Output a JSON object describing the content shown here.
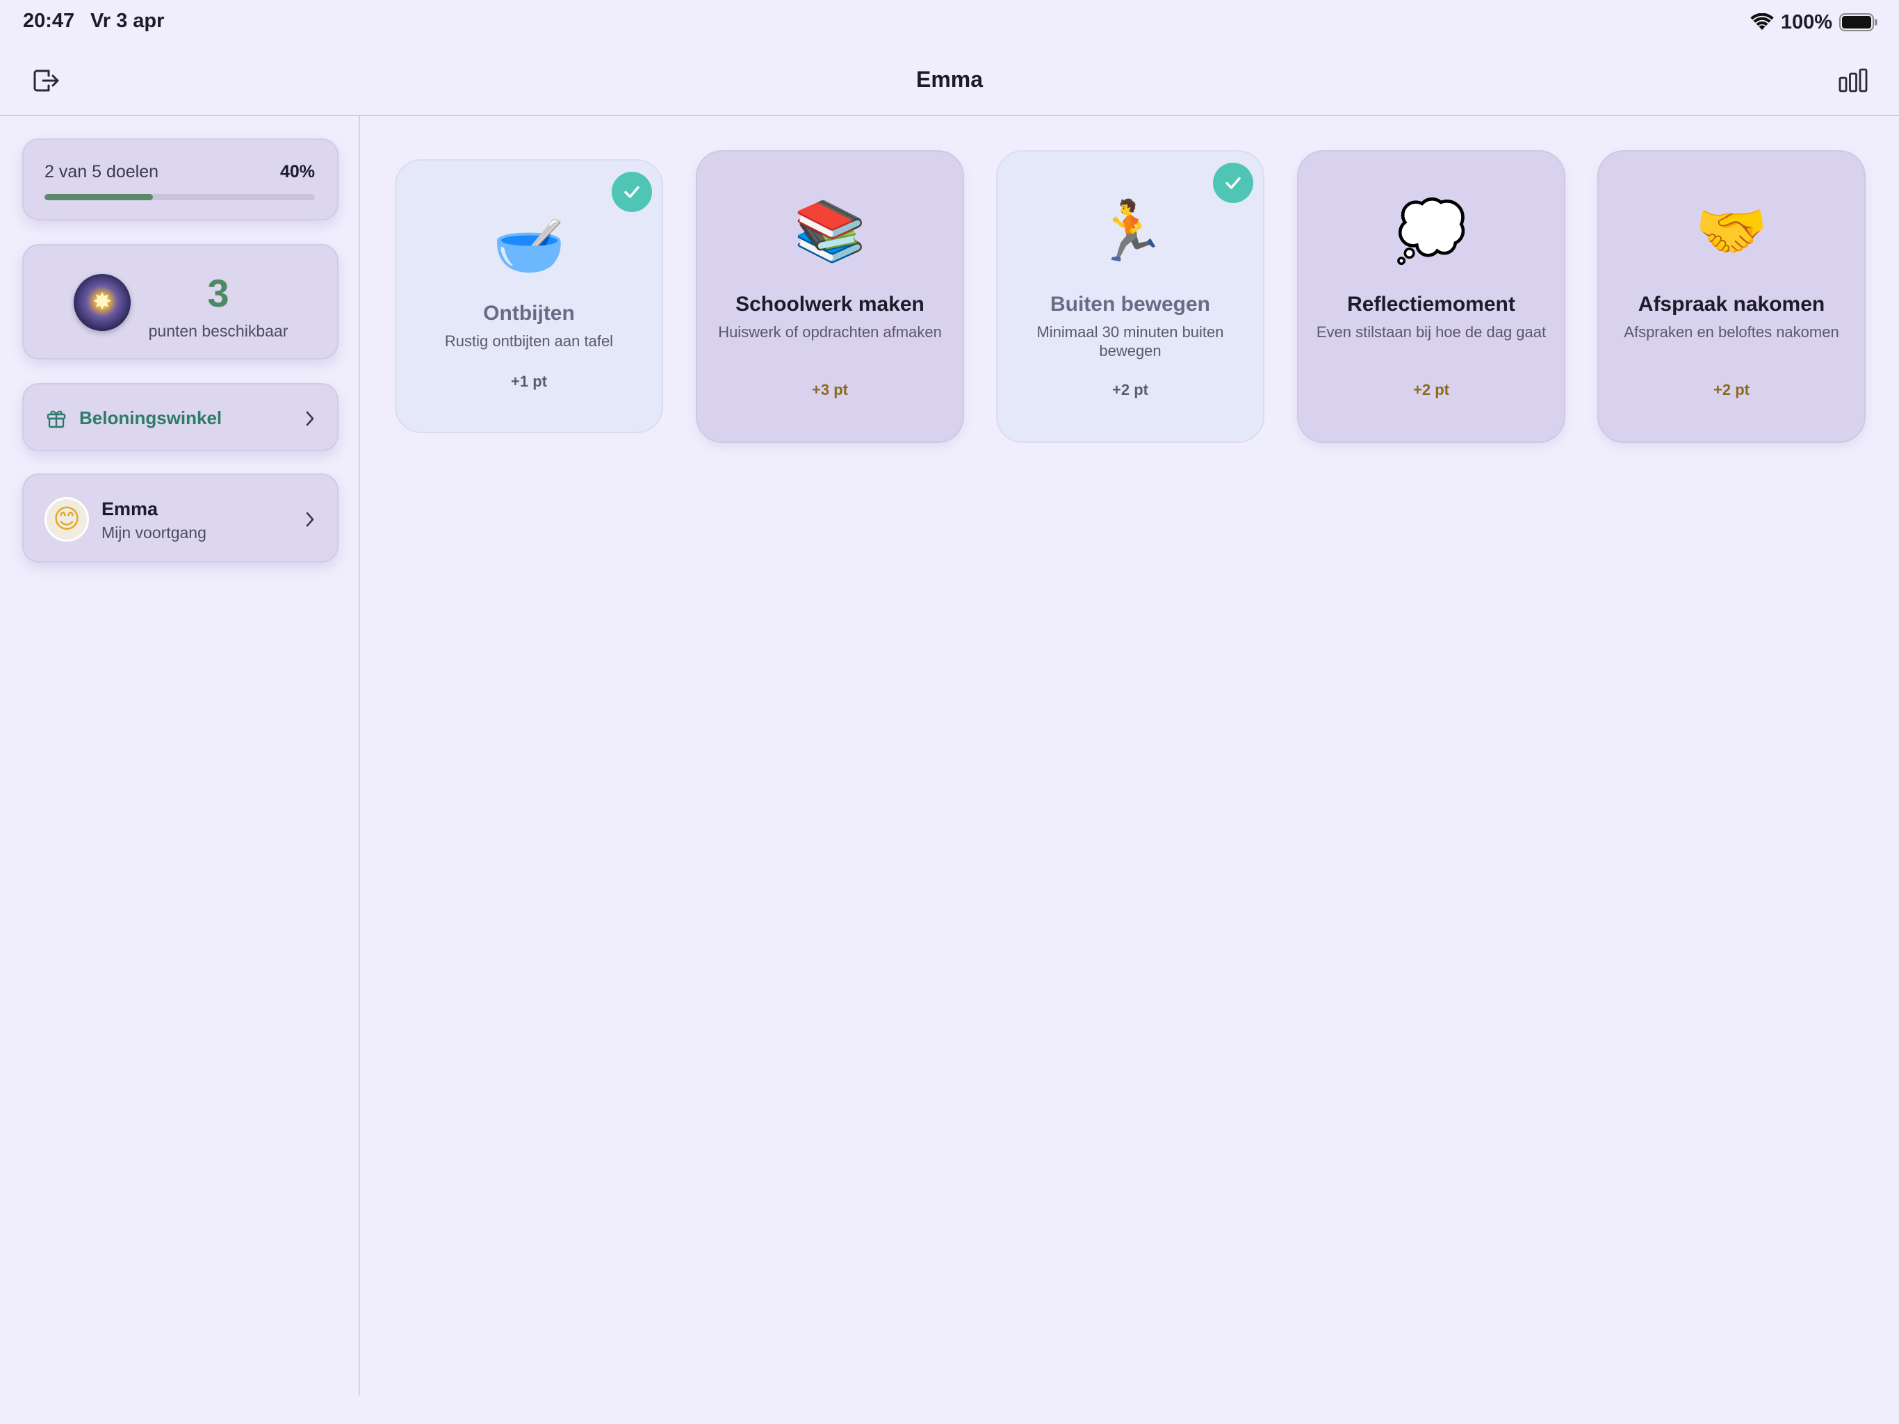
{
  "status_bar": {
    "time": "20:47",
    "date": "Vr 3 apr",
    "battery": "100%"
  },
  "header": {
    "title": "Emma",
    "logout_icon": "logout-icon",
    "stats_icon": "bar-chart-icon"
  },
  "sidebar": {
    "progress": {
      "label": "2 van 5 doelen",
      "percent_label": "40%",
      "fraction": 0.4
    },
    "points": {
      "value": "3",
      "label": "punten beschikbaar"
    },
    "shop": {
      "label": "Beloningswinkel",
      "icon": "gift-icon"
    },
    "profile": {
      "avatar": "😊",
      "name": "Emma",
      "subtitle": "Mijn voortgang"
    }
  },
  "goals": [
    {
      "emoji": "🥣",
      "title": "Ontbijten",
      "description": "Rustig ontbijten aan tafel",
      "points": "+1 pt",
      "done": true
    },
    {
      "emoji": "📚",
      "title": "Schoolwerk maken",
      "description": "Huiswerk of opdrachten afmaken",
      "points": "+3 pt",
      "done": false
    },
    {
      "emoji": "🏃",
      "title": "Buiten bewegen",
      "description": "Minimaal 30 minuten buiten bewegen",
      "points": "+2 pt",
      "done": true
    },
    {
      "emoji": "💭",
      "title": "Reflectiemoment",
      "description": "Even stilstaan bij hoe de dag gaat",
      "points": "+2 pt",
      "done": false
    },
    {
      "emoji": "🤝",
      "title": "Afspraak nakomen",
      "description": "Afspraken en beloftes nakomen",
      "points": "+2 pt",
      "done": false
    }
  ],
  "colors": {
    "background": "#f0eefd",
    "card": "#dcd6ef",
    "accent_green": "#4b8a63",
    "check": "#4fc5b6",
    "shop_text": "#2f7a6a",
    "points_text": "#8a6a1a"
  }
}
